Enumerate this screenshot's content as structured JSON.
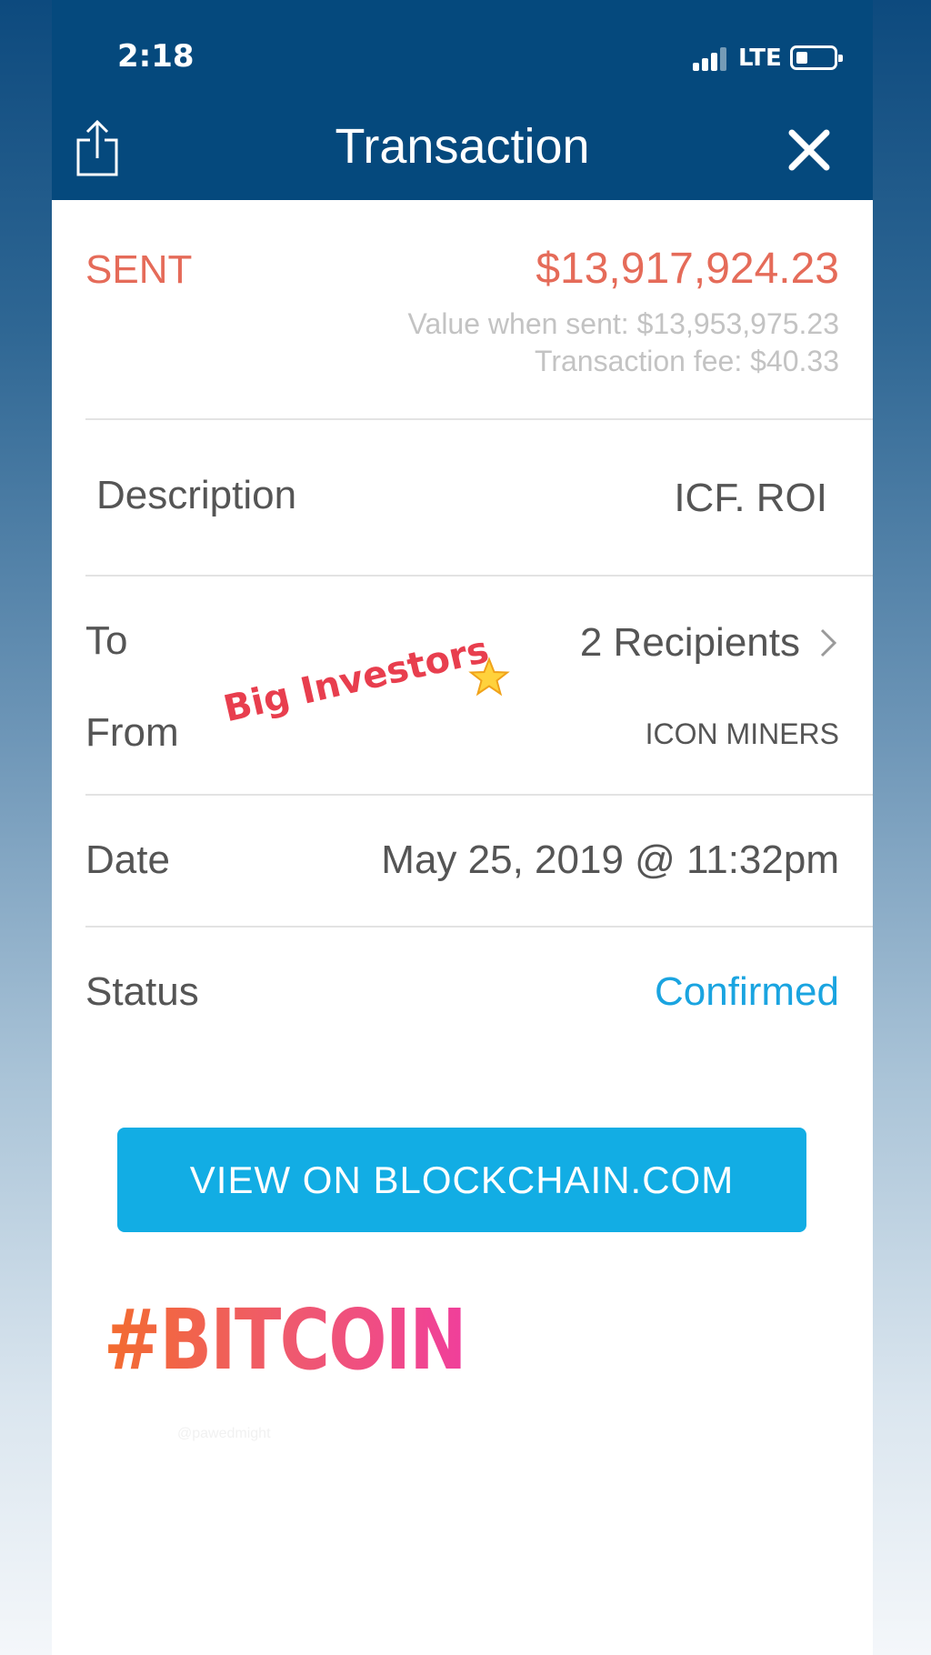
{
  "status_bar": {
    "time": "2:18",
    "network": "LTE",
    "icons": [
      "signal-icon",
      "battery-icon"
    ]
  },
  "nav": {
    "title": "Transaction",
    "left_icon": "share-icon",
    "right_icon": "close-icon"
  },
  "summary": {
    "direction": "SENT",
    "amount": "$13,917,924.23",
    "value_when_sent": "Value when sent: $13,953,975.23",
    "transaction_fee": "Transaction fee: $40.33"
  },
  "details": {
    "description_label": "Description",
    "description_value": "ICF. ROI",
    "to_label": "To",
    "to_value": "2 Recipients",
    "from_label": "From",
    "from_value": "ICON MINERS",
    "date_label": "Date",
    "date_value": "May 25, 2019 @ 11:32pm",
    "status_label": "Status",
    "status_value": "Confirmed"
  },
  "stickers": {
    "investors": "Big Investors",
    "hashtag": "#BITCOIN",
    "handle": "@pawedmight"
  },
  "button": {
    "label": "VIEW ON BLOCKCHAIN.COM"
  },
  "colors": {
    "header": "#05497d",
    "sent": "#e56b59",
    "confirmed": "#1aa4e0",
    "button": "#12ade4"
  }
}
